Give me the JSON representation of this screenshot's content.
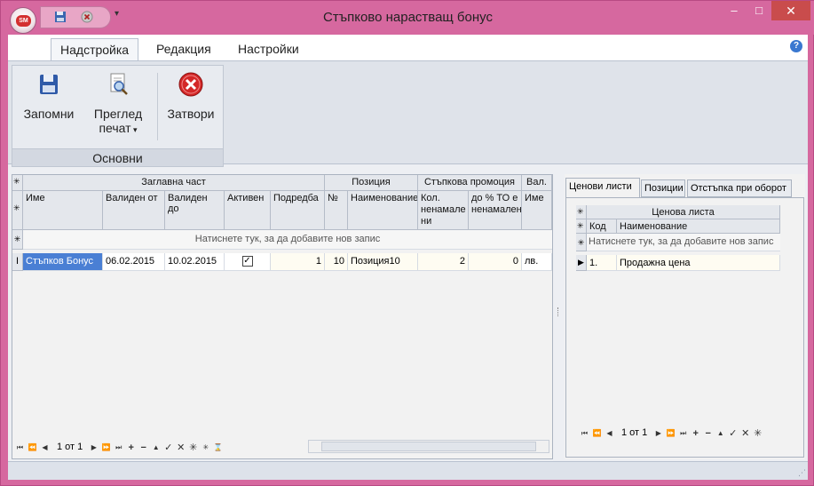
{
  "window": {
    "title": "Стъпково нарастващ бонус",
    "orb_text": "SM",
    "minimize": "–",
    "maximize": "□",
    "close": "✕"
  },
  "ribbon": {
    "tabs": [
      {
        "label": "Надстройка",
        "active": true
      },
      {
        "label": "Редакция",
        "active": false
      },
      {
        "label": "Настройки",
        "active": false
      }
    ],
    "help": "?",
    "group": {
      "label": "Основни",
      "save_label": "Запомни",
      "preview_label_1": "Преглед",
      "preview_label_2": "печат",
      "close_label": "Затвори"
    }
  },
  "grid": {
    "bands": {
      "main": "Заглавна част",
      "position": "Позиция",
      "promo": "Стъпкова промоция",
      "currency": "Вал."
    },
    "columns": {
      "name": "Име",
      "valid_from": "Валиден от",
      "valid_to": "Валиден до",
      "active": "Активен",
      "order": "Подредба",
      "num": "№",
      "pos_name": "Наименование",
      "qty": "Кол. ненамале ни",
      "pct": "до % ТО е ненамален",
      "cur_name": "Име"
    },
    "add_row": "Натиснете тук, за да добавите нов запис",
    "rows": [
      {
        "name": "Стъпков Бонус",
        "valid_from": "06.02.2015",
        "valid_to": "10.02.2015",
        "active_mark": "✓",
        "order": "1",
        "num": "10",
        "pos_name": "Позиция10",
        "qty": "2",
        "pct": "0",
        "cur": "лв."
      }
    ],
    "row_indicator": "I",
    "pager": "1 от 1"
  },
  "side": {
    "tabs": [
      {
        "label": "Ценови листи",
        "active": true
      },
      {
        "label": "Позиции",
        "active": false
      },
      {
        "label": "Отстъпка при оборот",
        "active": false
      }
    ],
    "band": "Ценова листа",
    "columns": {
      "code": "Код",
      "name": "Наименование"
    },
    "add_row": "Натиснете тук, за да добавите нов запис",
    "rows": [
      {
        "code": "1.",
        "name": "Продажна цена"
      }
    ],
    "pager": "1 от 1"
  },
  "colors": {
    "title_bar": "#d6689f",
    "close_button": "#c94c4c",
    "ribbon": "#dfe3ea",
    "selected_cell": "#4a7fd4"
  }
}
